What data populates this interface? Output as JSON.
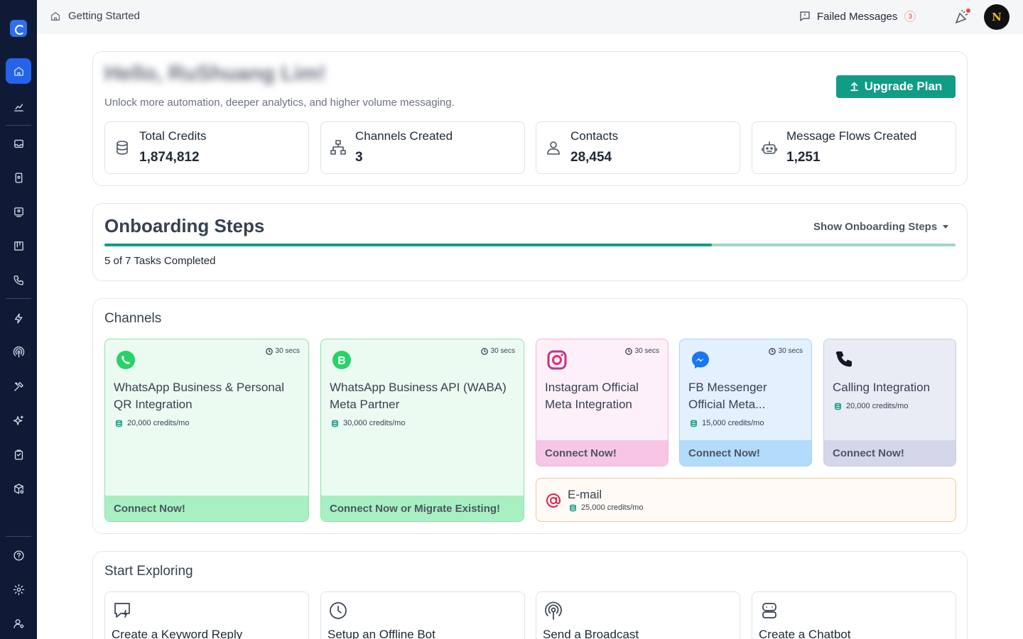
{
  "topbar": {
    "breadcrumb": "Getting Started",
    "failed_messages": "Failed Messages",
    "failed_count": "3",
    "avatar_initials": "N"
  },
  "hero": {
    "greeting": "Hello, RuShuang Lim!",
    "subtitle": "Unlock more automation, deeper analytics, and higher volume messaging.",
    "upgrade_label": "Upgrade Plan"
  },
  "stats": [
    {
      "label": "Total Credits",
      "value": "1,874,812",
      "icon": "database-icon"
    },
    {
      "label": "Channels Created",
      "value": "3",
      "icon": "hierarchy-icon"
    },
    {
      "label": "Contacts",
      "value": "28,454",
      "icon": "user-icon"
    },
    {
      "label": "Message Flows Created",
      "value": "1,251",
      "icon": "robot-icon"
    }
  ],
  "onboarding": {
    "title": "Onboarding Steps",
    "toggle": "Show Onboarding Steps",
    "completed": "5 of 7 Tasks Completed",
    "progress_fraction": 0.714
  },
  "channels": {
    "title": "Channels",
    "items": [
      {
        "name": "WhatsApp Business & Personal QR Integration",
        "time": "30 secs",
        "credits": "20,000 credits/mo",
        "cta": "Connect Now!"
      },
      {
        "name": "WhatsApp Business API (WABA) Meta Partner",
        "time": "30 secs",
        "credits": "30,000 credits/mo",
        "cta": "Connect Now or Migrate Existing!"
      },
      {
        "name": "Instagram Official Meta Integration",
        "time": "30 secs",
        "cta": "Connect Now!"
      },
      {
        "name": "FB Messenger Official Meta...",
        "time": "30 secs",
        "credits": "15,000 credits/mo",
        "cta": "Connect Now!"
      },
      {
        "name": "Calling Integration",
        "credits": "20,000 credits/mo",
        "cta": "Connect Now!"
      },
      {
        "name": "E-mail",
        "credits": "25,000 credits/mo"
      }
    ]
  },
  "explore": {
    "title": "Start Exploring",
    "items": [
      {
        "label": "Create a Keyword Reply",
        "icon": "keyword-reply-icon"
      },
      {
        "label": "Setup an Offline Bot",
        "icon": "clock-icon"
      },
      {
        "label": "Send a Broadcast",
        "icon": "broadcast-icon"
      },
      {
        "label": "Create a Chatbot",
        "icon": "chatbot-icon"
      }
    ]
  },
  "colors": {
    "sidebar_bg": "#0f1b36",
    "accent": "#119c86",
    "active_nav": "#2563eb"
  }
}
